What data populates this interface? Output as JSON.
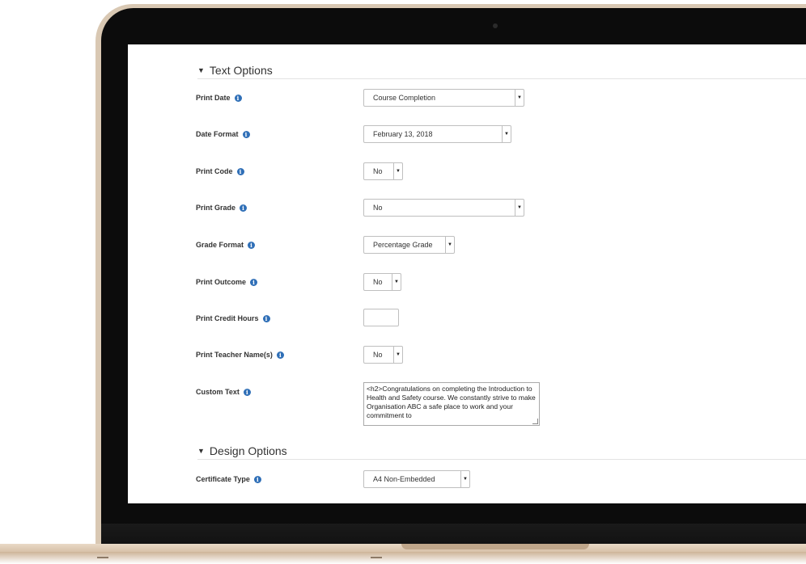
{
  "sections": {
    "text_options": "Text Options",
    "design_options": "Design Options"
  },
  "fields": {
    "print_date": {
      "label": "Print Date",
      "value": "Course Completion"
    },
    "date_format": {
      "label": "Date Format",
      "value": "February 13, 2018"
    },
    "print_code": {
      "label": "Print Code",
      "value": "No"
    },
    "print_grade": {
      "label": "Print Grade",
      "value": "No"
    },
    "grade_format": {
      "label": "Grade Format",
      "value": "Percentage Grade"
    },
    "print_outcome": {
      "label": "Print Outcome",
      "value": "No"
    },
    "print_credit_hours": {
      "label": "Print Credit Hours",
      "value": ""
    },
    "print_teacher_names": {
      "label": "Print Teacher Name(s)",
      "value": "No"
    },
    "custom_text": {
      "label": "Custom Text",
      "value": "<h2>Congratulations on completing the Introduction to Health and Safety course.  We constantly strive to make Organisation ABC a safe place to work and your commitment to"
    },
    "certificate_type": {
      "label": "Certificate Type",
      "value": "A4 Non-Embedded"
    }
  },
  "icons": {
    "info": "info-icon",
    "caret": "caret-down-icon",
    "dropdown": "chevron-down-icon"
  },
  "colors": {
    "info_icon": "#2f6fb7",
    "laptop_frame": "#d9c8b3",
    "bezel": "#0c0c0c"
  }
}
